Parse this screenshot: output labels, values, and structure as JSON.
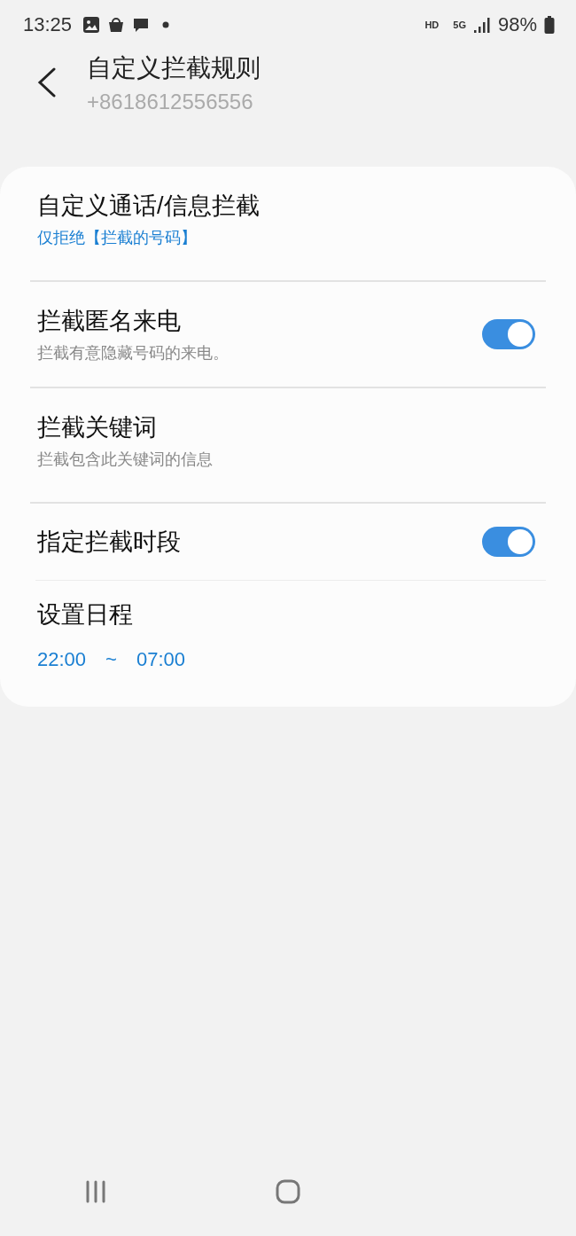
{
  "status_bar": {
    "time": "13:25",
    "network": "HD",
    "generation": "5G",
    "battery": "98%"
  },
  "header": {
    "title": "自定义拦截规则",
    "subtitle": "+8618612556556"
  },
  "items": [
    {
      "kind": "nav",
      "title": "自定义通话/信息拦截",
      "summary": "仅拒绝【拦截的号码】",
      "accent": true
    },
    {
      "kind": "toggle",
      "title": "拦截匿名来电",
      "summary": "拦截有意隐藏号码的来电。",
      "accent": false,
      "on": true
    },
    {
      "kind": "nav",
      "title": "拦截关键词",
      "summary": "拦截包含此关键词的信息",
      "accent": false
    },
    {
      "kind": "toggle",
      "title": "指定拦截时段",
      "on": true
    },
    {
      "kind": "schedule",
      "title": "设置日程",
      "start": "22:00",
      "separator": "~",
      "end": "07:00"
    }
  ]
}
